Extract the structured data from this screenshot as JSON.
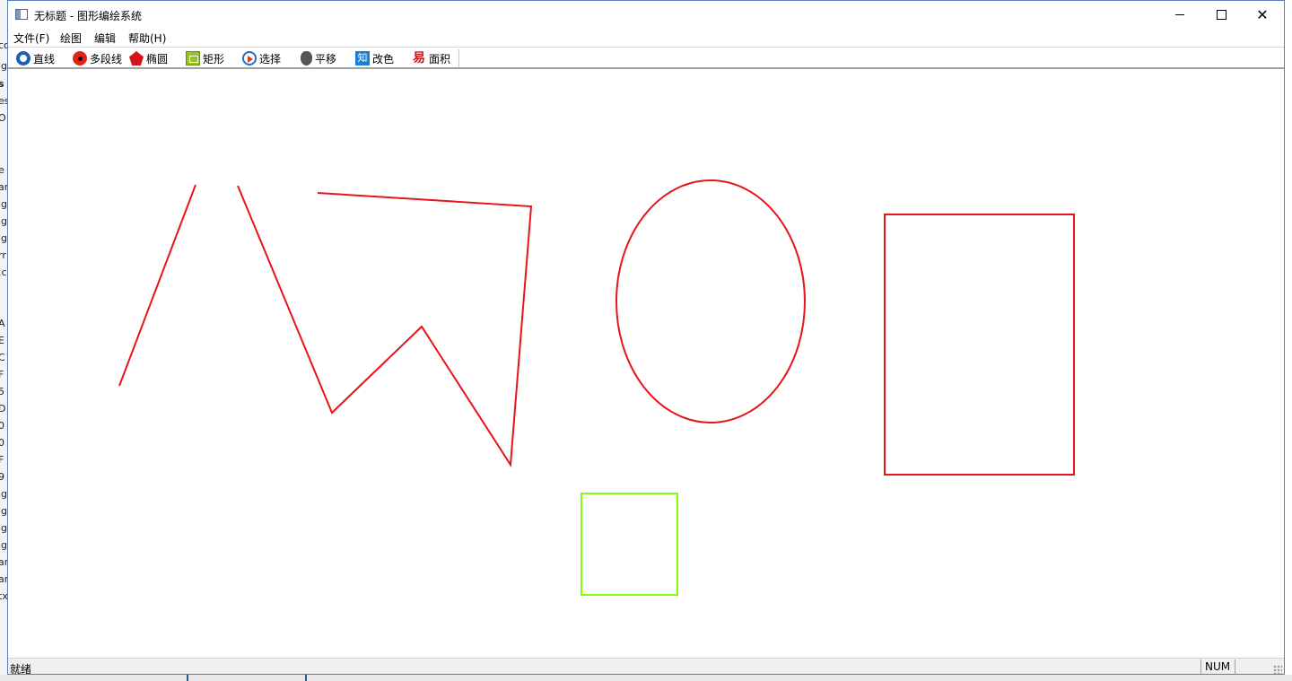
{
  "window": {
    "title": "无标题 - 图形编绘系统",
    "minimize_glyph": "—",
    "close_glyph": "✕"
  },
  "menu": [
    {
      "label": "文件(F)"
    },
    {
      "label": "绘图"
    },
    {
      "label": "编辑"
    },
    {
      "label": "帮助(H)"
    }
  ],
  "toolbar": [
    {
      "label": "直线",
      "icon": "line-icon"
    },
    {
      "label": "多段线",
      "icon": "polyline-icon"
    },
    {
      "label": "椭圆",
      "icon": "ellipse-icon"
    },
    {
      "label": "矩形",
      "icon": "rectangle-icon"
    },
    {
      "label": "选择",
      "icon": "select-icon"
    },
    {
      "label": "平移",
      "icon": "move-icon"
    },
    {
      "label": "改色",
      "icon": "color-icon"
    },
    {
      "label": "面积",
      "icon": "area-icon"
    }
  ],
  "toolbar_icon_glyphs": {
    "color": "知",
    "area": "易"
  },
  "canvas": {
    "stroke_colors": {
      "primary": "#e8141b",
      "highlight": "#7fff00"
    }
  },
  "status": {
    "text": "就绪",
    "num": "NUM"
  },
  "background_window_fragments": [
    "co",
    "ig",
    "s",
    "es",
    "O",
    "e",
    "ar",
    "ig",
    "ig",
    "ig",
    "rr",
    ".c",
    "A",
    "E",
    "C",
    "F",
    "5",
    "D",
    "0",
    "0",
    "F",
    "9",
    "ig",
    "ig",
    "ig",
    "ig",
    "ar",
    "ar",
    "tx"
  ]
}
